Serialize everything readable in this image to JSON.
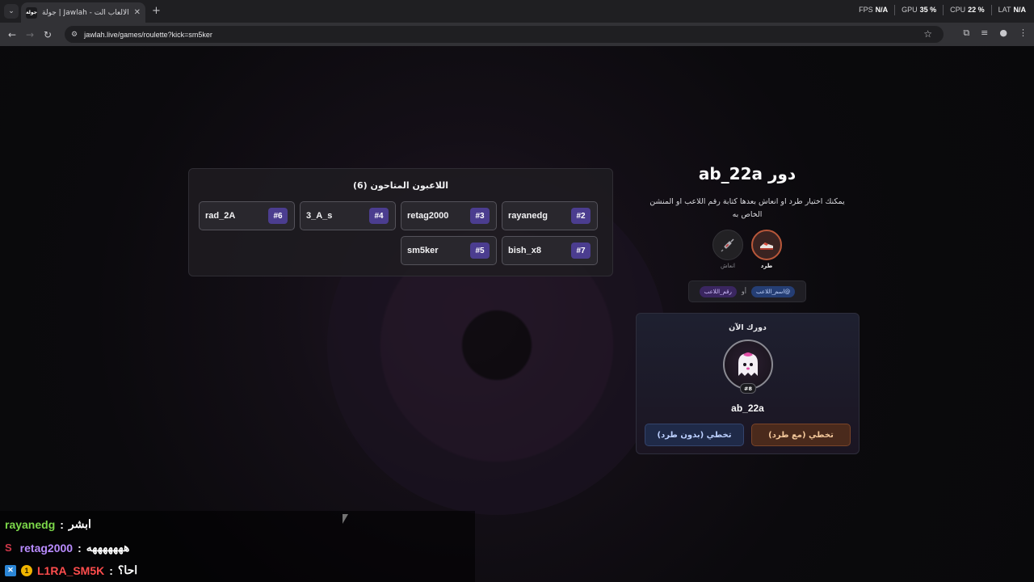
{
  "browser": {
    "tab_title": "جولة | Jawlah - منصة الألعاب الت...",
    "favicon_text": "جولة",
    "url": "jawlah.live/games/roulette?kick=sm5ker",
    "perf": {
      "fps_label": "FPS",
      "fps_value": "N/A",
      "gpu_label": "GPU",
      "gpu_value": "35 %",
      "cpu_label": "CPU",
      "cpu_value": "22 %",
      "lat_label": "LAT",
      "lat_value": "N/A"
    }
  },
  "players": {
    "title": "اللاعبون المتاحون (6)",
    "list": [
      {
        "name": "rayanedg",
        "num": "#2"
      },
      {
        "name": "retag2000",
        "num": "#3"
      },
      {
        "name": "3_A_s",
        "num": "#4"
      },
      {
        "name": "rad_2A",
        "num": "#6"
      },
      {
        "name": "bish_x8",
        "num": "#7"
      },
      {
        "name": "sm5ker",
        "num": "#5"
      }
    ]
  },
  "turn": {
    "title": "دور ab_22a",
    "description": "يمكنك اختيار طرد او انعاش بعدها كتابة رقم اللاعب او المنشن الخاص به",
    "kick_label": "طرد",
    "revive_label": "انعاش",
    "kick_icon": "shoe-icon",
    "revive_icon": "syringe-icon",
    "mention_name": "@اسم_اللاعب",
    "mention_or": "أو",
    "mention_number": "رقم_اللاعب"
  },
  "current": {
    "title": "دورك الآن",
    "player_name": "ab_22a",
    "player_num": "#8",
    "skip_with_kick": "تخطي (مع طرد)",
    "skip_without_kick": "تخطي (بدون طرد)"
  },
  "chat": [
    {
      "user": "rayanedg",
      "msg": "ابشر",
      "color": "#7cd84a",
      "badge": ""
    },
    {
      "user": "retag2000",
      "msg": "هههههههه",
      "color": "#b98cff",
      "badge": "S"
    },
    {
      "user": "L1RA_SM5K",
      "msg": "احا؟",
      "color": "#ff4d4d",
      "badge": "1"
    }
  ],
  "colors": {
    "accent_purple": "#4b3d8f",
    "kick_orange": "#b8573a"
  }
}
